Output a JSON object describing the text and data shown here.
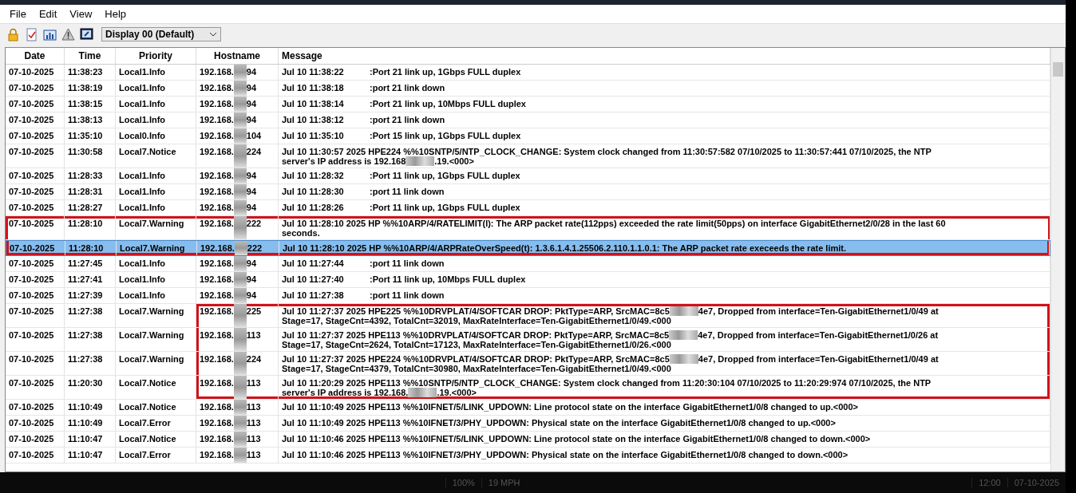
{
  "menu": [
    "File",
    "Edit",
    "View",
    "Help"
  ],
  "toolbar": {
    "display_select": "Display 00 (Default)"
  },
  "table": {
    "columns": [
      "Date",
      "Time",
      "Priority",
      "Hostname",
      "Message"
    ],
    "rows": [
      {
        "date": "07-10-2025",
        "time": "11:38:23",
        "priority": "Local1.Info",
        "host_prefix": "192.168.",
        "host_suffix": "94",
        "stamp": "Jul 10 11:38:22",
        "text": ":Port 21 link up, 1Gbps FULL duplex",
        "selected": false
      },
      {
        "date": "07-10-2025",
        "time": "11:38:19",
        "priority": "Local1.Info",
        "host_prefix": "192.168.",
        "host_suffix": "94",
        "stamp": "Jul 10 11:38:18",
        "text": ":port 21 link down",
        "selected": false
      },
      {
        "date": "07-10-2025",
        "time": "11:38:15",
        "priority": "Local1.Info",
        "host_prefix": "192.168.",
        "host_suffix": "94",
        "stamp": "Jul 10 11:38:14",
        "text": ":Port 21 link up, 10Mbps FULL duplex",
        "selected": false
      },
      {
        "date": "07-10-2025",
        "time": "11:38:13",
        "priority": "Local1.Info",
        "host_prefix": "192.168.",
        "host_suffix": "94",
        "stamp": "Jul 10 11:38:12",
        "text": ":port 21 link down",
        "selected": false
      },
      {
        "date": "07-10-2025",
        "time": "11:35:10",
        "priority": "Local0.Info",
        "host_prefix": "192.168.",
        "host_suffix": "104",
        "stamp": "Jul 10 11:35:10",
        "text": ":Port 15 link up, 1Gbps FULL duplex",
        "selected": false
      },
      {
        "date": "07-10-2025",
        "time": "11:30:58",
        "priority": "Local7.Notice",
        "host_prefix": "192.168.",
        "host_suffix": "224",
        "lines": [
          [
            "Jul 10 11:30:57 2025 HPE224 %%10SNTP/5/NTP_CLOCK_CHANGE: System clock changed from 11:30:57:582 07/10/2025 to 11:30:57:441 07/10/2025, the NTP"
          ],
          [
            "server's IP address is 192.168",
            ".19.<000>"
          ]
        ],
        "selected": false
      },
      {
        "date": "07-10-2025",
        "time": "11:28:33",
        "priority": "Local1.Info",
        "host_prefix": "192.168.",
        "host_suffix": "94",
        "stamp": "Jul 10 11:28:32",
        "text": ":Port 11 link up, 1Gbps FULL duplex",
        "selected": false
      },
      {
        "date": "07-10-2025",
        "time": "11:28:31",
        "priority": "Local1.Info",
        "host_prefix": "192.168.",
        "host_suffix": "94",
        "stamp": "Jul 10 11:28:30",
        "text": ":port 11 link down",
        "selected": false
      },
      {
        "date": "07-10-2025",
        "time": "11:28:27",
        "priority": "Local1.Info",
        "host_prefix": "192.168.",
        "host_suffix": "94",
        "stamp": "Jul 10 11:28:26",
        "text": ":Port 11 link up, 1Gbps FULL duplex",
        "selected": false
      },
      {
        "date": "07-10-2025",
        "time": "11:28:10",
        "priority": "Local7.Warning",
        "host_prefix": "192.168.",
        "host_suffix": "222",
        "lines": [
          [
            "Jul 10 11:28:10 2025 HP %%10ARP/4/RATELIMIT(l): The ARP packet rate(112pps) exceeded the rate limit(50pps) on interface GigabitEthernet2/0/28 in the last 60"
          ],
          [
            "seconds."
          ]
        ],
        "selected": false,
        "boxed": true
      },
      {
        "date": "07-10-2025",
        "time": "11:28:10",
        "priority": "Local7.Warning",
        "host_prefix": "192.168.",
        "host_suffix": "222",
        "lines": [
          [
            "Jul 10 11:28:10 2025 HP %%10ARP/4/ARPRateOverSpeed(t):   1.3.6.1.4.1.25506.2.110.1.1.0.1: The ARP packet rate execeeds the rate limit."
          ]
        ],
        "selected": true,
        "boxed": true
      },
      {
        "date": "07-10-2025",
        "time": "11:27:45",
        "priority": "Local1.Info",
        "host_prefix": "192.168.",
        "host_suffix": "94",
        "stamp": "Jul 10 11:27:44",
        "text": ":port 11 link down",
        "selected": false
      },
      {
        "date": "07-10-2025",
        "time": "11:27:41",
        "priority": "Local1.Info",
        "host_prefix": "192.168.",
        "host_suffix": "94",
        "stamp": "Jul 10 11:27:40",
        "text": ":Port 11 link up, 10Mbps FULL duplex",
        "selected": false
      },
      {
        "date": "07-10-2025",
        "time": "11:27:39",
        "priority": "Local1.Info",
        "host_prefix": "192.168.",
        "host_suffix": "94",
        "stamp": "Jul 10 11:27:38",
        "text": ":port 11 link down",
        "selected": false
      },
      {
        "date": "07-10-2025",
        "time": "11:27:38",
        "priority": "Local7.Warning",
        "host_prefix": "192.168.",
        "host_suffix": "225",
        "lines": [
          [
            "Jul 10 11:27:37 2025 HPE225 %%10DRVPLAT/4/SOFTCAR DROP:  PktType=ARP, SrcMAC=8c5",
            "4e7, Dropped from interface=Ten-GigabitEthernet1/0/49 at"
          ],
          [
            "Stage=17, StageCnt=4392, TotalCnt=32019, MaxRateInterface=Ten-GigabitEthernet1/0/49.<000"
          ]
        ],
        "selected": false,
        "hostname_boxed": true
      },
      {
        "date": "07-10-2025",
        "time": "11:27:38",
        "priority": "Local7.Warning",
        "host_prefix": "192.168.",
        "host_suffix": "113",
        "lines": [
          [
            "Jul 10 11:27:37 2025 HPE113 %%10DRVPLAT/4/SOFTCAR DROP:  PktType=ARP, SrcMAC=8c5",
            "4e7, Dropped from interface=Ten-GigabitEthernet1/0/26 at"
          ],
          [
            "Stage=17, StageCnt=2624, TotalCnt=17123, MaxRateInterface=Ten-GigabitEthernet1/0/26.<000"
          ]
        ],
        "selected": false,
        "hostname_boxed": true
      },
      {
        "date": "07-10-2025",
        "time": "11:27:38",
        "priority": "Local7.Warning",
        "host_prefix": "192.168.",
        "host_suffix": "224",
        "lines": [
          [
            "Jul 10 11:27:37 2025 HPE224 %%10DRVPLAT/4/SOFTCAR DROP:  PktType=ARP, SrcMAC=8c5",
            "4e7, Dropped from interface=Ten-GigabitEthernet1/0/49 at"
          ],
          [
            "Stage=17, StageCnt=4379, TotalCnt=30980, MaxRateInterface=Ten-GigabitEthernet1/0/49.<000"
          ]
        ],
        "selected": false,
        "hostname_boxed": true
      },
      {
        "date": "07-10-2025",
        "time": "11:20:30",
        "priority": "Local7.Notice",
        "host_prefix": "192.168.",
        "host_suffix": "113",
        "lines": [
          [
            "Jul 10 11:20:29 2025 HPE113 %%10SNTP/5/NTP_CLOCK_CHANGE: System clock changed from 11:20:30:104 07/10/2025 to 11:20:29:974 07/10/2025, the NTP"
          ],
          [
            "server's IP address is 192.168.",
            ".19.<000>"
          ]
        ],
        "selected": false,
        "hostname_boxed": true
      },
      {
        "date": "07-10-2025",
        "time": "11:10:49",
        "priority": "Local7.Notice",
        "host_prefix": "192.168.",
        "host_suffix": "113",
        "lines": [
          [
            "Jul 10 11:10:49 2025 HPE113 %%10IFNET/5/LINK_UPDOWN: Line protocol state on the interface GigabitEthernet1/0/8 changed to up.<000>"
          ]
        ],
        "selected": false
      },
      {
        "date": "07-10-2025",
        "time": "11:10:49",
        "priority": "Local7.Error",
        "host_prefix": "192.168.",
        "host_suffix": "113",
        "lines": [
          [
            "Jul 10 11:10:49 2025 HPE113 %%10IFNET/3/PHY_UPDOWN: Physical state on the interface GigabitEthernet1/0/8 changed to up.<000>"
          ]
        ],
        "selected": false
      },
      {
        "date": "07-10-2025",
        "time": "11:10:47",
        "priority": "Local7.Notice",
        "host_prefix": "192.168.",
        "host_suffix": "113",
        "lines": [
          [
            "Jul 10 11:10:46 2025 HPE113 %%10IFNET/5/LINK_UPDOWN: Line protocol state on the interface GigabitEthernet1/0/8 changed to down.<000>"
          ]
        ],
        "selected": false
      },
      {
        "date": "07-10-2025",
        "time": "11:10:47",
        "priority": "Local7.Error",
        "host_prefix": "192.168.",
        "host_suffix": "113",
        "lines": [
          [
            "Jul 10 11:10:46 2025 HPE113 %%10IFNET/3/PHY_UPDOWN: Physical state on the interface GigabitEthernet1/0/8 changed to down.<000>"
          ]
        ],
        "selected": false
      }
    ]
  },
  "status_bar": [
    "100%",
    "19 MPH",
    "12:00",
    "07-10-2025"
  ]
}
